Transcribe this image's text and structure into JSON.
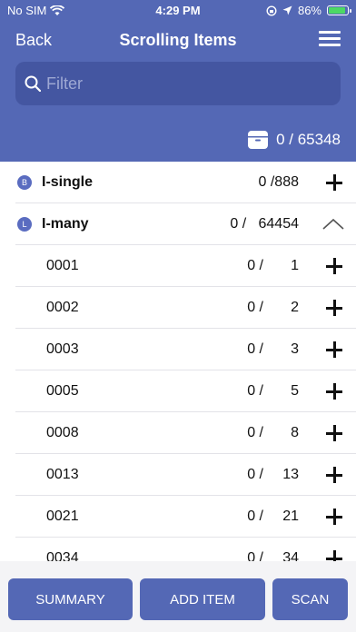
{
  "status_bar": {
    "carrier": "No SIM",
    "time": "4:29 PM",
    "battery": "86%"
  },
  "navbar": {
    "back_label": "Back",
    "title": "Scrolling Items"
  },
  "search": {
    "placeholder": "Filter"
  },
  "totals": {
    "text": "0 / 65348"
  },
  "groups": [
    {
      "badge": "B",
      "name": "I-single",
      "count": "0 /888"
    },
    {
      "badge": "L",
      "name": "I-many",
      "count": "0 /   64454"
    }
  ],
  "items": [
    {
      "name": "0001",
      "count": "0 /",
      "total": "1"
    },
    {
      "name": "0002",
      "count": "0 /",
      "total": "2"
    },
    {
      "name": "0003",
      "count": "0 /",
      "total": "3"
    },
    {
      "name": "0005",
      "count": "0 /",
      "total": "5"
    },
    {
      "name": "0008",
      "count": "0 /",
      "total": "8"
    },
    {
      "name": "0013",
      "count": "0 /",
      "total": "13"
    },
    {
      "name": "0021",
      "count": "0 /",
      "total": "21"
    },
    {
      "name": "0034",
      "count": "0 /",
      "total": "34"
    }
  ],
  "footer": {
    "summary": "SUMMARY",
    "add_item": "ADD ITEM",
    "scan": "SCAN"
  }
}
